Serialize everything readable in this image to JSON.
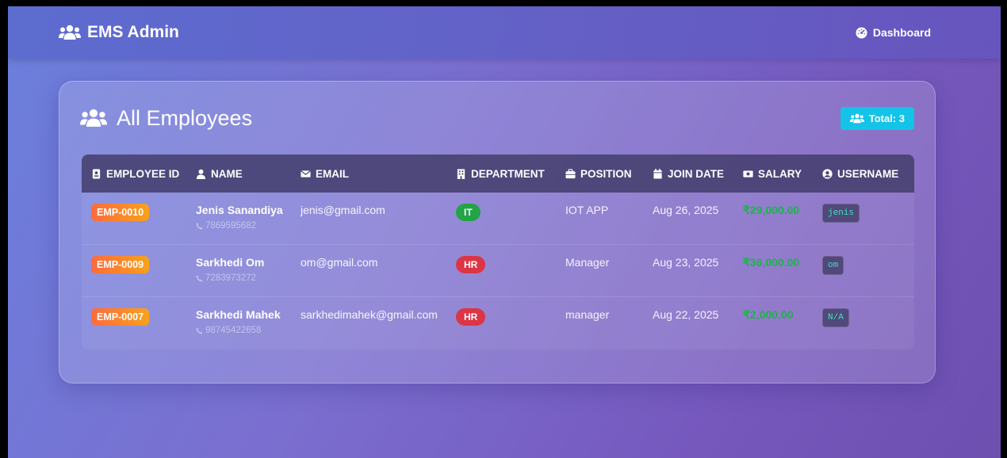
{
  "navbar": {
    "brand": "EMS Admin",
    "dashboard_label": "Dashboard"
  },
  "card": {
    "title": "All Employees",
    "total_label": "Total: 3"
  },
  "table": {
    "headers": [
      "EMPLOYEE ID",
      "NAME",
      "EMAIL",
      "DEPARTMENT",
      "POSITION",
      "JOIN DATE",
      "SALARY",
      "USERNAME"
    ],
    "rows": [
      {
        "id": "EMP-0010",
        "name": "Jenis Sanandiya",
        "phone": "7869595682",
        "email": "jenis@gmail.com",
        "department": "IT",
        "position": "IOT APP",
        "join_date": "Aug 26, 2025",
        "salary": "₹29,000.00",
        "username": "jenis"
      },
      {
        "id": "EMP-0009",
        "name": "Sarkhedi Om",
        "phone": "7283973272",
        "email": "om@gmail.com",
        "department": "HR",
        "position": "Manager",
        "join_date": "Aug 23, 2025",
        "salary": "₹36,000.00",
        "username": "om"
      },
      {
        "id": "EMP-0007",
        "name": "Sarkhedi Mahek",
        "phone": "98745422658",
        "email": "sarkhedimahek@gmail.com",
        "department": "HR",
        "position": "manager",
        "join_date": "Aug 22, 2025",
        "salary": "₹2,000.00",
        "username": "N/A"
      }
    ]
  },
  "colors": {
    "it_badge": "#22a447",
    "hr_badge": "#dc3545",
    "total_badge": "#14c3e8",
    "salary": "#1eb14d"
  },
  "icons": {
    "brand": "users-icon",
    "dashboard": "dashboard-gauge-icon",
    "phone": "phone-icon"
  }
}
